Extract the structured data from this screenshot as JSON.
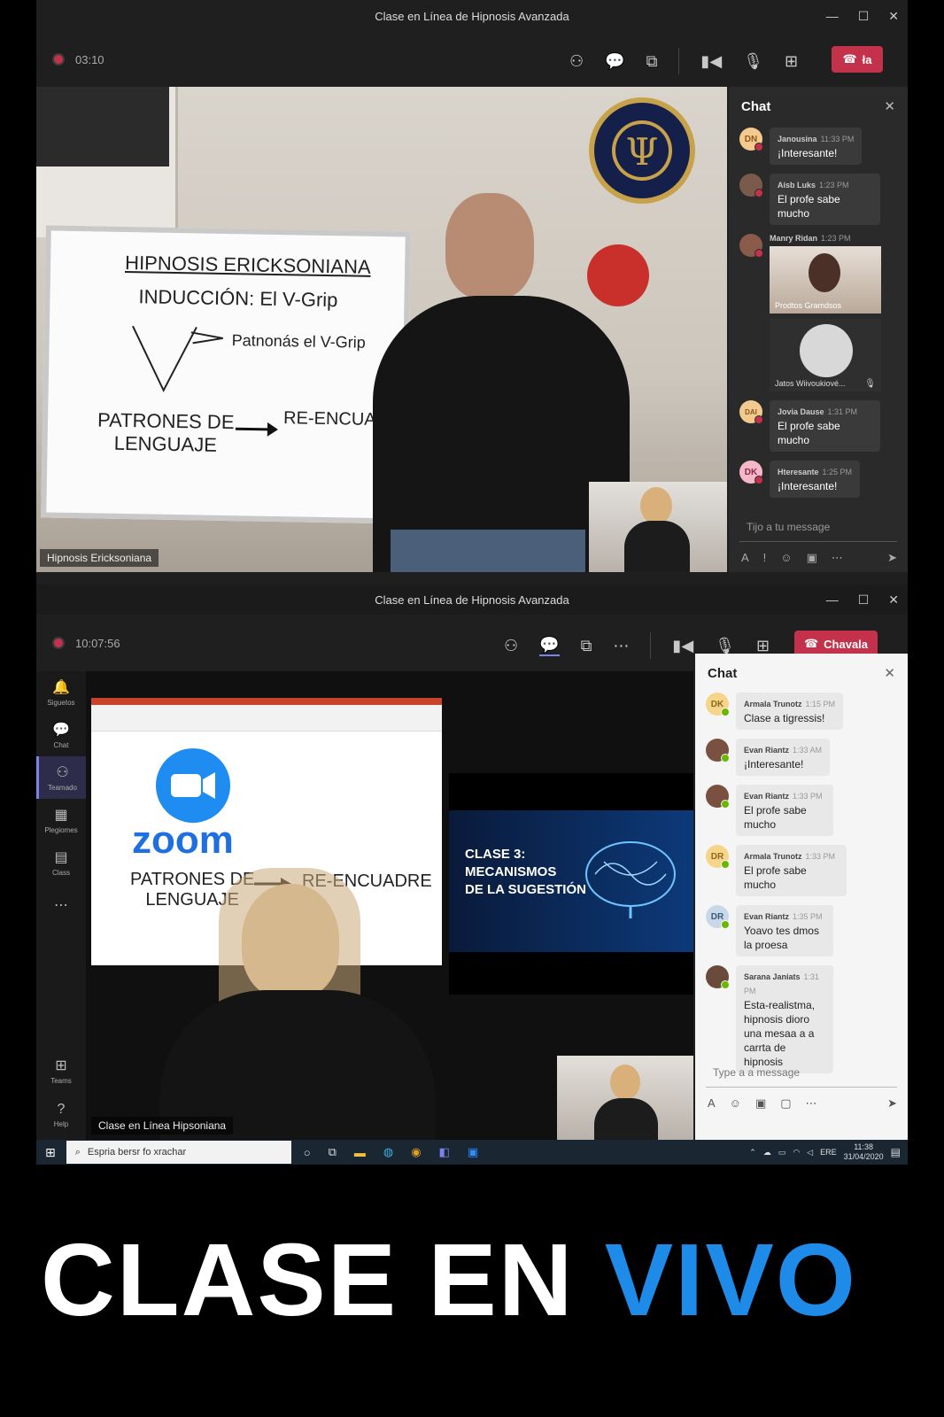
{
  "win1": {
    "title": "Clase en Línea de Hipnosis Avanzada",
    "timer": "03:10",
    "hangup_label": "ła",
    "caption": "Hipnosis Ericksoniana",
    "whiteboard": {
      "line1": "HIPNOSIS ERICKSONIANA",
      "line2": "INDUCCIÓN: El V-Grip",
      "line3": "Patnonás el V-Grip",
      "line4a": "PATRONES DE",
      "line4b": "LENGUAJE",
      "line5": "RE-ENCUADRE"
    },
    "chat": {
      "title": "Chat",
      "messages": [
        {
          "initials": "DN",
          "name": "Janousina",
          "time": "11:33 PM",
          "text": "¡Interesante!",
          "color": "#f2c98e"
        },
        {
          "initials": "",
          "name": "Aisb Luks",
          "time": "1:23 PM",
          "text": "El profe sabe mucho",
          "color": "#7a5a4a"
        },
        {
          "initials": "",
          "name": "Manry Ridan",
          "time": "1:23 PM",
          "text": "",
          "color": "#8a5a4a"
        },
        {
          "initials": "DAI",
          "name": "Jovia Dause",
          "time": "1:31 PM",
          "text": "El profe sabe mucho",
          "color": "#f2c98e"
        },
        {
          "initials": "DK",
          "name": "Hteresante",
          "time": "1:25 PM",
          "text": "¡Interesante!",
          "color": "#f4b8c8"
        }
      ],
      "tile1_label": "Prodtos Gramdsos",
      "tile2_label": "Jatos Wiivoukiové...",
      "compose_placeholder": "Tijo a tu message"
    }
  },
  "win2": {
    "title": "Clase en Línea de Hipnosis Avanzada",
    "timer": "10:07:56",
    "hangup_label": "Chavala",
    "caption": "Clase en Línea Hipsoniana",
    "rail": [
      {
        "label": "Siguetos",
        "icon": "bell-icon"
      },
      {
        "label": "Chat",
        "icon": "chat-icon"
      },
      {
        "label": "Teamado",
        "icon": "teams-icon"
      },
      {
        "label": "Plegiomes",
        "icon": "calendar-icon"
      },
      {
        "label": "Class",
        "icon": "file-icon"
      }
    ],
    "rail_bottom": [
      {
        "label": "Teams"
      },
      {
        "label": "Help"
      }
    ],
    "slide": {
      "logo_text": "zoom",
      "line1a": "PATRONES DE",
      "line1b": "LENGUAJE",
      "line2": "RE-ENCUADRE"
    },
    "brain_slide": {
      "line1": "CLASE 3:",
      "line2": "MECANISMOS",
      "line3": "DE LA SUGESTIÓN"
    },
    "chat": {
      "title": "Chat",
      "messages": [
        {
          "initials": "DK",
          "name": "Armala Trunotz",
          "time": "1:15 PM",
          "text": "Clase a tigressis!",
          "color": "#f6d58a"
        },
        {
          "initials": "",
          "name": "Evan Riantz",
          "time": "1:33 AM",
          "text": "¡Interesante!",
          "color": "#7a5040"
        },
        {
          "initials": "",
          "name": "Evan Riantz",
          "time": "1:33 PM",
          "text": "El profe sabe mucho",
          "color": "#7a5040"
        },
        {
          "initials": "DR",
          "name": "Armala Trunotz",
          "time": "1:33 PM",
          "text": "El profe sabe mucho",
          "color": "#f6d58a"
        },
        {
          "initials": "DR",
          "name": "Evan Riantz",
          "time": "1:35 PM",
          "text": "Yoavo tes dmos la proesa",
          "color": "#c8d8e8"
        },
        {
          "initials": "",
          "name": "Sarana Janiats",
          "time": "1:31 PM",
          "text": "Esta-realistma, hipnosis dioro una mesaa a a carrta de hipnosis",
          "color": "#6a4a3a"
        }
      ],
      "compose_placeholder": "Type a a message"
    },
    "taskbar": {
      "search_placeholder": "Espria bersr fo xrachar",
      "lang": "ERE",
      "time": "11:38",
      "date": "31/04/2020"
    }
  },
  "banner": {
    "white": "CLASE EN ",
    "blue": "VIVO"
  }
}
